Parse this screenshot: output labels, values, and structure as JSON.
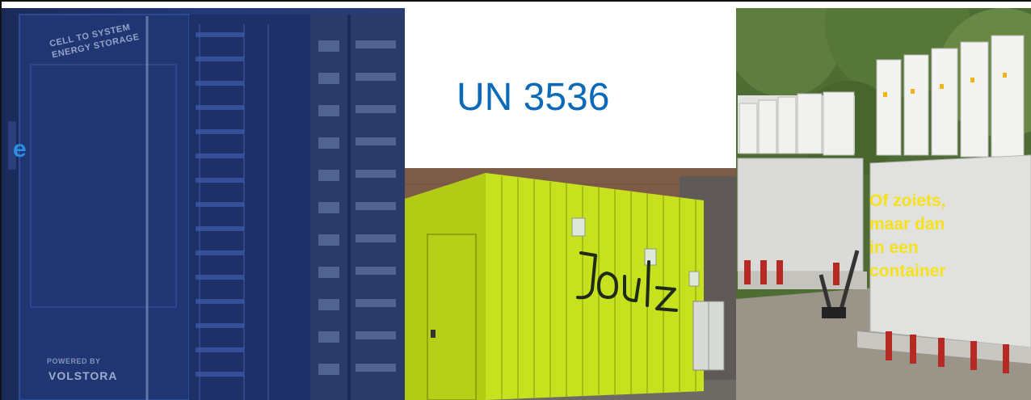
{
  "title": "UN 3536",
  "left_image": {
    "alt": "Volstora battery storage rack",
    "label_top": "CELL TO SYSTEM\nENERGY STORAGE",
    "label_powered": "POWERED BY",
    "label_brand": "VOLSTORA",
    "fragment_letter": "e"
  },
  "middle_image": {
    "alt": "Lime green Joulz container",
    "brand_text": "Joulz"
  },
  "right_image": {
    "alt": "Battery modules with inverters",
    "note": "Of zoiets,\nmaar dan\nin een\ncontainer"
  },
  "colors": {
    "title": "#0b6ab8",
    "note": "#f5e21a",
    "container": "#c6e11e",
    "rack_blue": "#1c2d5e"
  }
}
